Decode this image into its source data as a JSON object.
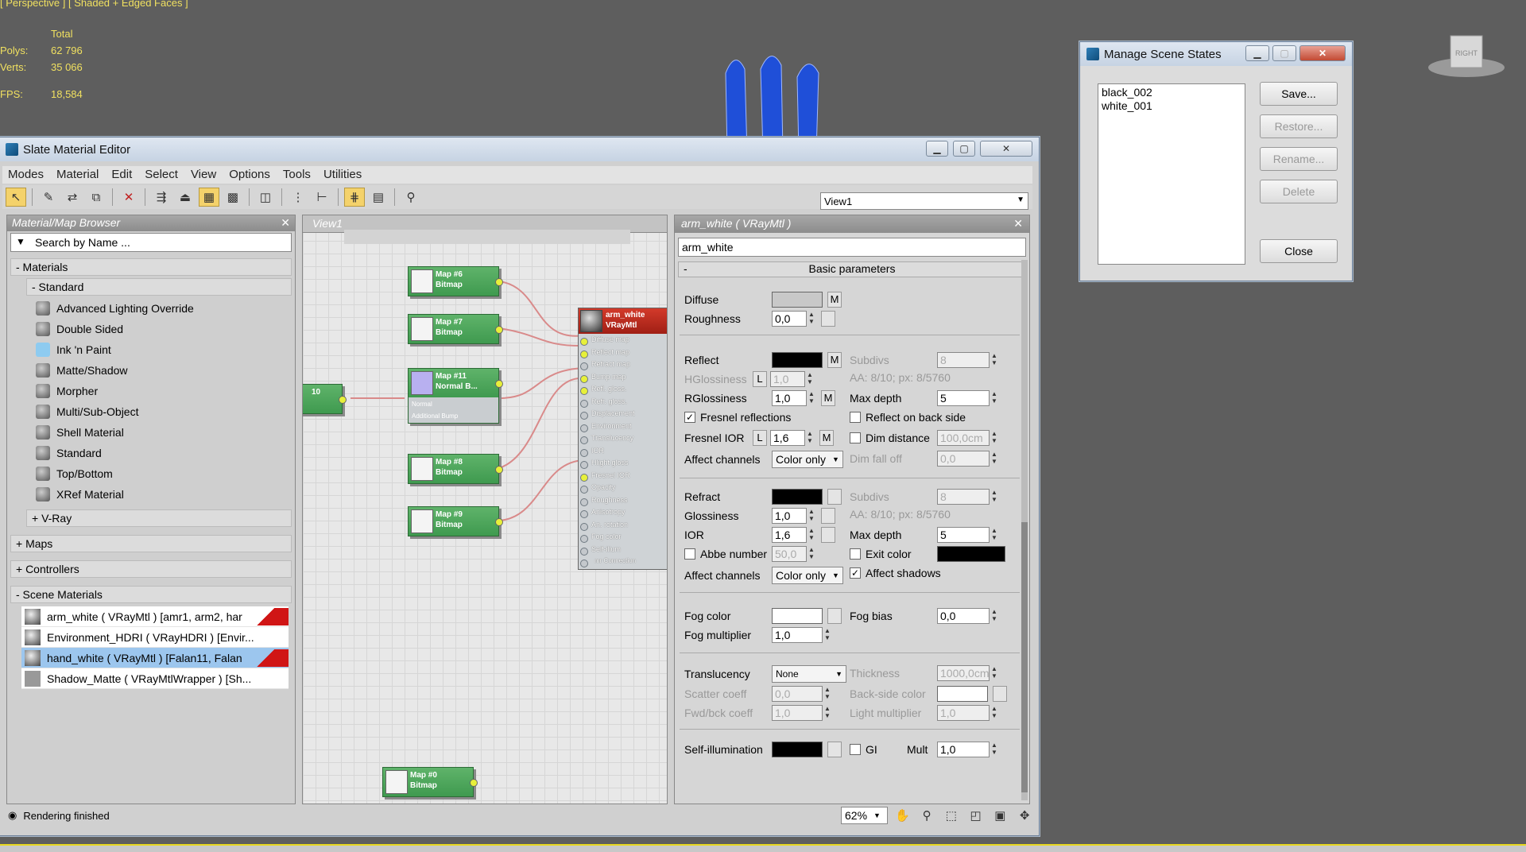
{
  "viewport": {
    "label": "[ Perspective ] [ Shaded + Edged Faces ]",
    "stats": {
      "header": "Total",
      "rows": [
        {
          "k": "Polys:",
          "v": "62 796"
        },
        {
          "k": "Verts:",
          "v": "35 066"
        },
        {
          "k": "FPS:",
          "v": "18,584"
        }
      ]
    },
    "viewcube": "RIGHT"
  },
  "slate": {
    "title": "Slate Material Editor",
    "menus": [
      "Modes",
      "Material",
      "Edit",
      "Select",
      "View",
      "Options",
      "Tools",
      "Utilities"
    ],
    "view_select": "View1",
    "browser": {
      "title": "Material/Map Browser",
      "search_placeholder": "Search by Name ...",
      "materials_group": "- Materials",
      "standard_group": "- Standard",
      "standard_items": [
        "Advanced Lighting Override",
        "Double Sided",
        "Ink 'n Paint",
        "Matte/Shadow",
        "Morpher",
        "Multi/Sub-Object",
        "Shell Material",
        "Standard",
        "Top/Bottom",
        "XRef Material"
      ],
      "vray_group": "+ V-Ray",
      "maps_group": "+ Maps",
      "controllers_group": "+ Controllers",
      "scene_group": "- Scene Materials",
      "scene_items": [
        "arm_white  ( VRayMtl )  [amr1, arm2, har",
        "Environment_HDRI  ( VRayHDRI )  [Envir...",
        "hand_white  ( VRayMtl )  [Falan11, Falan",
        "Shadow_Matte  ( VRayMtlWrapper )  [Sh..."
      ]
    },
    "status": "Rendering finished",
    "view": {
      "tab": "View1",
      "nodes": [
        {
          "name": "Map #6",
          "type": "Bitmap"
        },
        {
          "name": "Map #7",
          "type": "Bitmap"
        },
        {
          "name": "Map #11",
          "type": "Normal B...",
          "slots": [
            "Normal",
            "Additional Bump"
          ]
        },
        {
          "name": "Map #8",
          "type": "Bitmap"
        },
        {
          "name": "Map #9",
          "type": "Bitmap"
        },
        {
          "name": "Map #0",
          "type": "Bitmap"
        },
        {
          "name": "10"
        }
      ],
      "material": {
        "name": "arm_white",
        "type": "VRayMtl",
        "slots": [
          "Diffuse map",
          "Reflect map",
          "Refract map",
          "Bump map",
          "Refl. gloss.",
          "Refr. gloss.",
          "Displacement",
          "Environment",
          "Translucency",
          "IOR",
          "Hlight gloss",
          "Fresnel IOR",
          "Opacity",
          "Roughness",
          "Anisotropy",
          "An. rotation",
          "Fog color",
          "Self-illum",
          "mr Connection"
        ]
      }
    },
    "params": {
      "title": "arm_white  ( VRayMtl )",
      "name": "arm_white",
      "rollout": "Basic parameters",
      "diffuse": "Diffuse",
      "roughness": "Roughness",
      "roughness_val": "0,0",
      "reflect": "Reflect",
      "hgloss": "HGlossiness",
      "hgloss_val": "1,0",
      "rgloss": "RGlossiness",
      "rgloss_val": "1,0",
      "subdivs": "Subdivs",
      "subdivs_val": "8",
      "aa1": "AA: 8/10; px: 8/5760",
      "maxdepth": "Max depth",
      "maxdepth_val": "5",
      "fresnel": "Fresnel reflections",
      "backside": "Reflect on back side",
      "fresnel_ior": "Fresnel IOR",
      "fresnel_ior_val": "1,6",
      "dimdist": "Dim distance",
      "dimdist_val": "100,0cm",
      "affect": "Affect channels",
      "affect_val": "Color only",
      "dimfall": "Dim fall off",
      "dimfall_val": "0,0",
      "refract": "Refract",
      "glossiness": "Glossiness",
      "gloss_val": "1,0",
      "ior": "IOR",
      "ior_val": "1,6",
      "abbe": "Abbe number",
      "abbe_val": "50,0",
      "exitcolor": "Exit color",
      "affectshadows": "Affect shadows",
      "aa2": "AA: 8/10; px: 8/5760",
      "fogcolor": "Fog color",
      "fogbias": "Fog bias",
      "fogbias_val": "0,0",
      "fogmult": "Fog multiplier",
      "fogmult_val": "1,0",
      "translucency": "Translucency",
      "transl_val": "None",
      "thickness": "Thickness",
      "thickness_val": "1000,0cm",
      "scatter": "Scatter coeff",
      "scatter_val": "0,0",
      "backside_color": "Back-side color",
      "fwdbck": "Fwd/bck coeff",
      "fwdbck_val": "1,0",
      "lightmult": "Light multiplier",
      "lightmult_val": "1,0",
      "selfillum": "Self-illumination",
      "gi": "GI",
      "mult": "Mult",
      "mult_val": "1,0",
      "m": "M",
      "l": "L"
    },
    "zoom": "62%"
  },
  "states": {
    "title": "Manage Scene States",
    "items": [
      "black_002",
      "white_001"
    ],
    "buttons": {
      "save": "Save...",
      "restore": "Restore...",
      "rename": "Rename...",
      "delete": "Delete",
      "close": "Close"
    }
  }
}
